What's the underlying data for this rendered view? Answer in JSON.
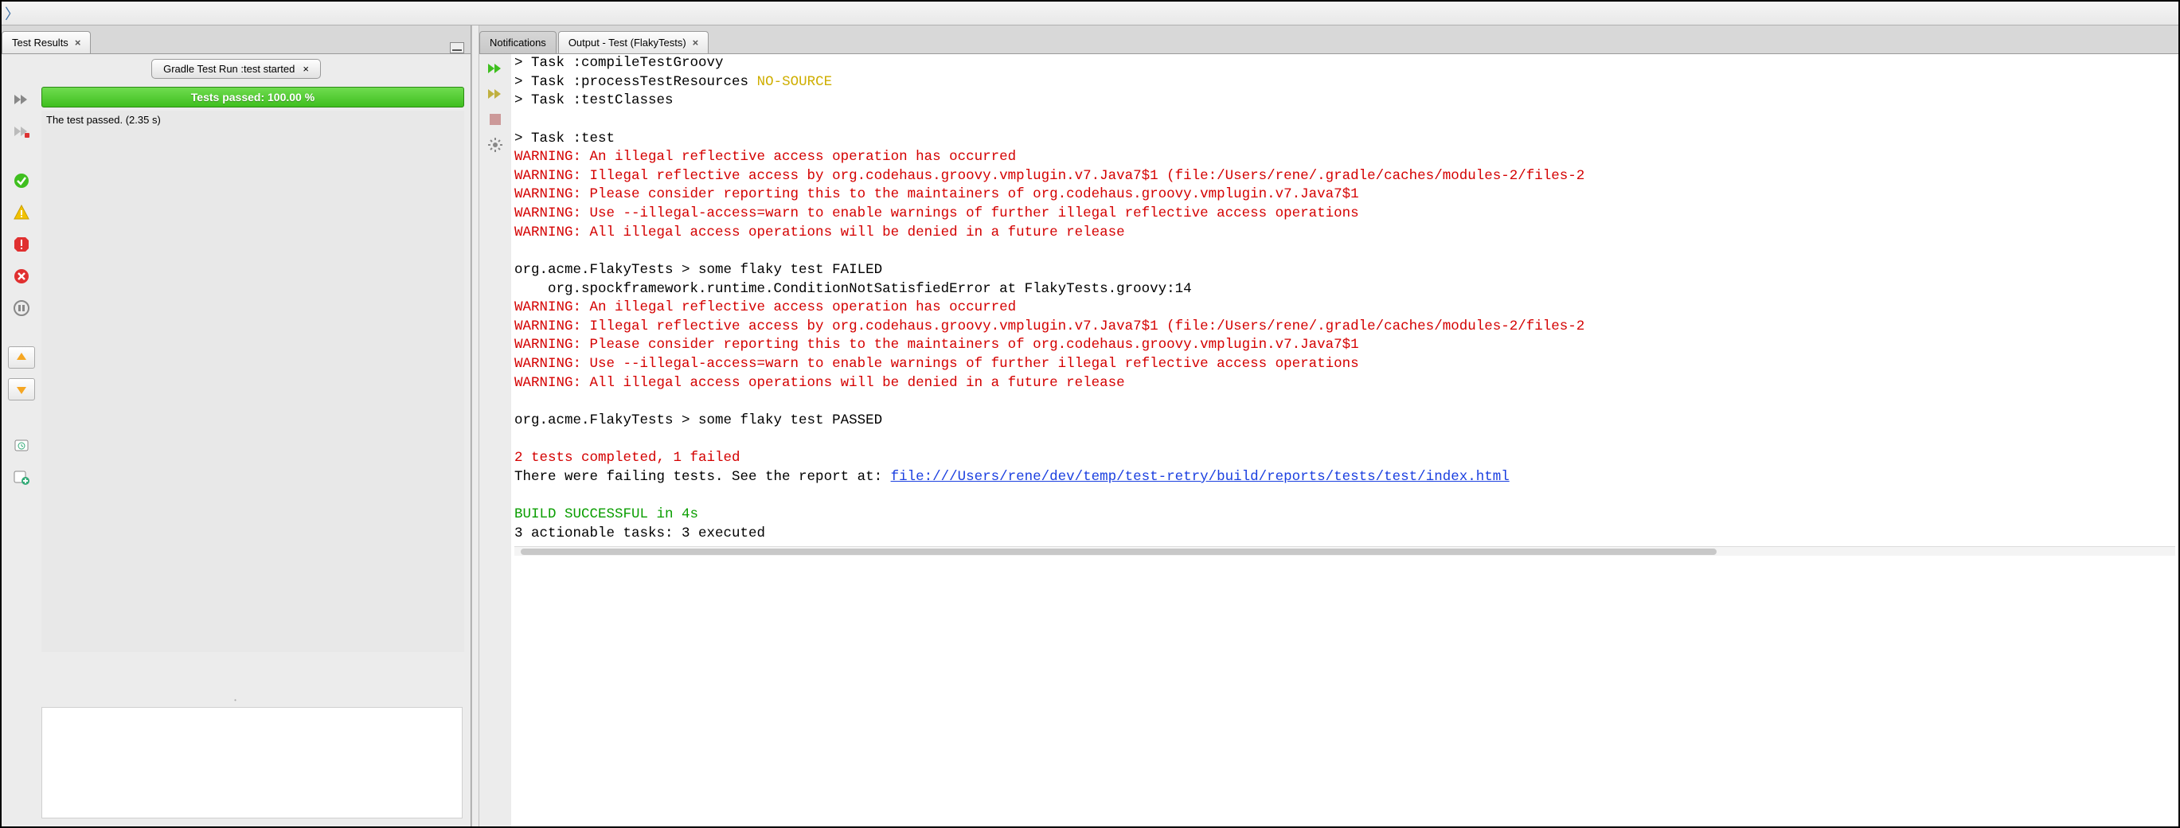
{
  "left": {
    "tab_label": "Test Results",
    "run_tab_label": "Gradle Test Run :test started",
    "progress_label": "Tests passed: 100.00 %",
    "result_message": "The test passed. (2.35 s)"
  },
  "right": {
    "tabs": [
      {
        "label": "Notifications",
        "active": false,
        "closable": false
      },
      {
        "label": "Output - Test (FlakyTests)",
        "active": true,
        "closable": true
      }
    ]
  },
  "console_lines": [
    {
      "segs": [
        {
          "t": "> Task :compileTestGroovy"
        }
      ]
    },
    {
      "segs": [
        {
          "t": "> Task :processTestResources "
        },
        {
          "t": "NO-SOURCE",
          "c": "amber"
        }
      ]
    },
    {
      "segs": [
        {
          "t": "> Task :testClasses"
        }
      ]
    },
    {
      "segs": [
        {
          "t": ""
        }
      ]
    },
    {
      "segs": [
        {
          "t": "> Task :test"
        }
      ]
    },
    {
      "segs": [
        {
          "t": "WARNING: An illegal reflective access operation has occurred",
          "c": "red"
        }
      ]
    },
    {
      "segs": [
        {
          "t": "WARNING: Illegal reflective access by org.codehaus.groovy.vmplugin.v7.Java7$1 (file:/Users/rene/.gradle/caches/modules-2/files-2",
          "c": "red"
        }
      ]
    },
    {
      "segs": [
        {
          "t": "WARNING: Please consider reporting this to the maintainers of org.codehaus.groovy.vmplugin.v7.Java7$1",
          "c": "red"
        }
      ]
    },
    {
      "segs": [
        {
          "t": "WARNING: Use --illegal-access=warn to enable warnings of further illegal reflective access operations",
          "c": "red"
        }
      ]
    },
    {
      "segs": [
        {
          "t": "WARNING: All illegal access operations will be denied in a future release",
          "c": "red"
        }
      ]
    },
    {
      "segs": [
        {
          "t": ""
        }
      ]
    },
    {
      "segs": [
        {
          "t": "org.acme.FlakyTests > some flaky test FAILED"
        }
      ]
    },
    {
      "segs": [
        {
          "t": "    org.spockframework.runtime.ConditionNotSatisfiedError at FlakyTests.groovy:14"
        }
      ]
    },
    {
      "segs": [
        {
          "t": "WARNING: An illegal reflective access operation has occurred",
          "c": "red"
        }
      ]
    },
    {
      "segs": [
        {
          "t": "WARNING: Illegal reflective access by org.codehaus.groovy.vmplugin.v7.Java7$1 (file:/Users/rene/.gradle/caches/modules-2/files-2",
          "c": "red"
        }
      ]
    },
    {
      "segs": [
        {
          "t": "WARNING: Please consider reporting this to the maintainers of org.codehaus.groovy.vmplugin.v7.Java7$1",
          "c": "red"
        }
      ]
    },
    {
      "segs": [
        {
          "t": "WARNING: Use --illegal-access=warn to enable warnings of further illegal reflective access operations",
          "c": "red"
        }
      ]
    },
    {
      "segs": [
        {
          "t": "WARNING: All illegal access operations will be denied in a future release",
          "c": "red"
        }
      ]
    },
    {
      "segs": [
        {
          "t": ""
        }
      ]
    },
    {
      "segs": [
        {
          "t": "org.acme.FlakyTests > some flaky test PASSED"
        }
      ]
    },
    {
      "segs": [
        {
          "t": ""
        }
      ]
    },
    {
      "segs": [
        {
          "t": "2 tests completed, 1 failed",
          "c": "red"
        }
      ]
    },
    {
      "segs": [
        {
          "t": "There were failing tests. See the report at: "
        },
        {
          "t": "file:///Users/rene/dev/temp/test-retry/build/reports/tests/test/index.html",
          "link": true
        }
      ]
    },
    {
      "segs": [
        {
          "t": ""
        }
      ]
    },
    {
      "segs": [
        {
          "t": "BUILD SUCCESSFUL in 4s",
          "c": "green"
        }
      ]
    },
    {
      "segs": [
        {
          "t": "3 actionable tasks: 3 executed"
        }
      ]
    }
  ]
}
